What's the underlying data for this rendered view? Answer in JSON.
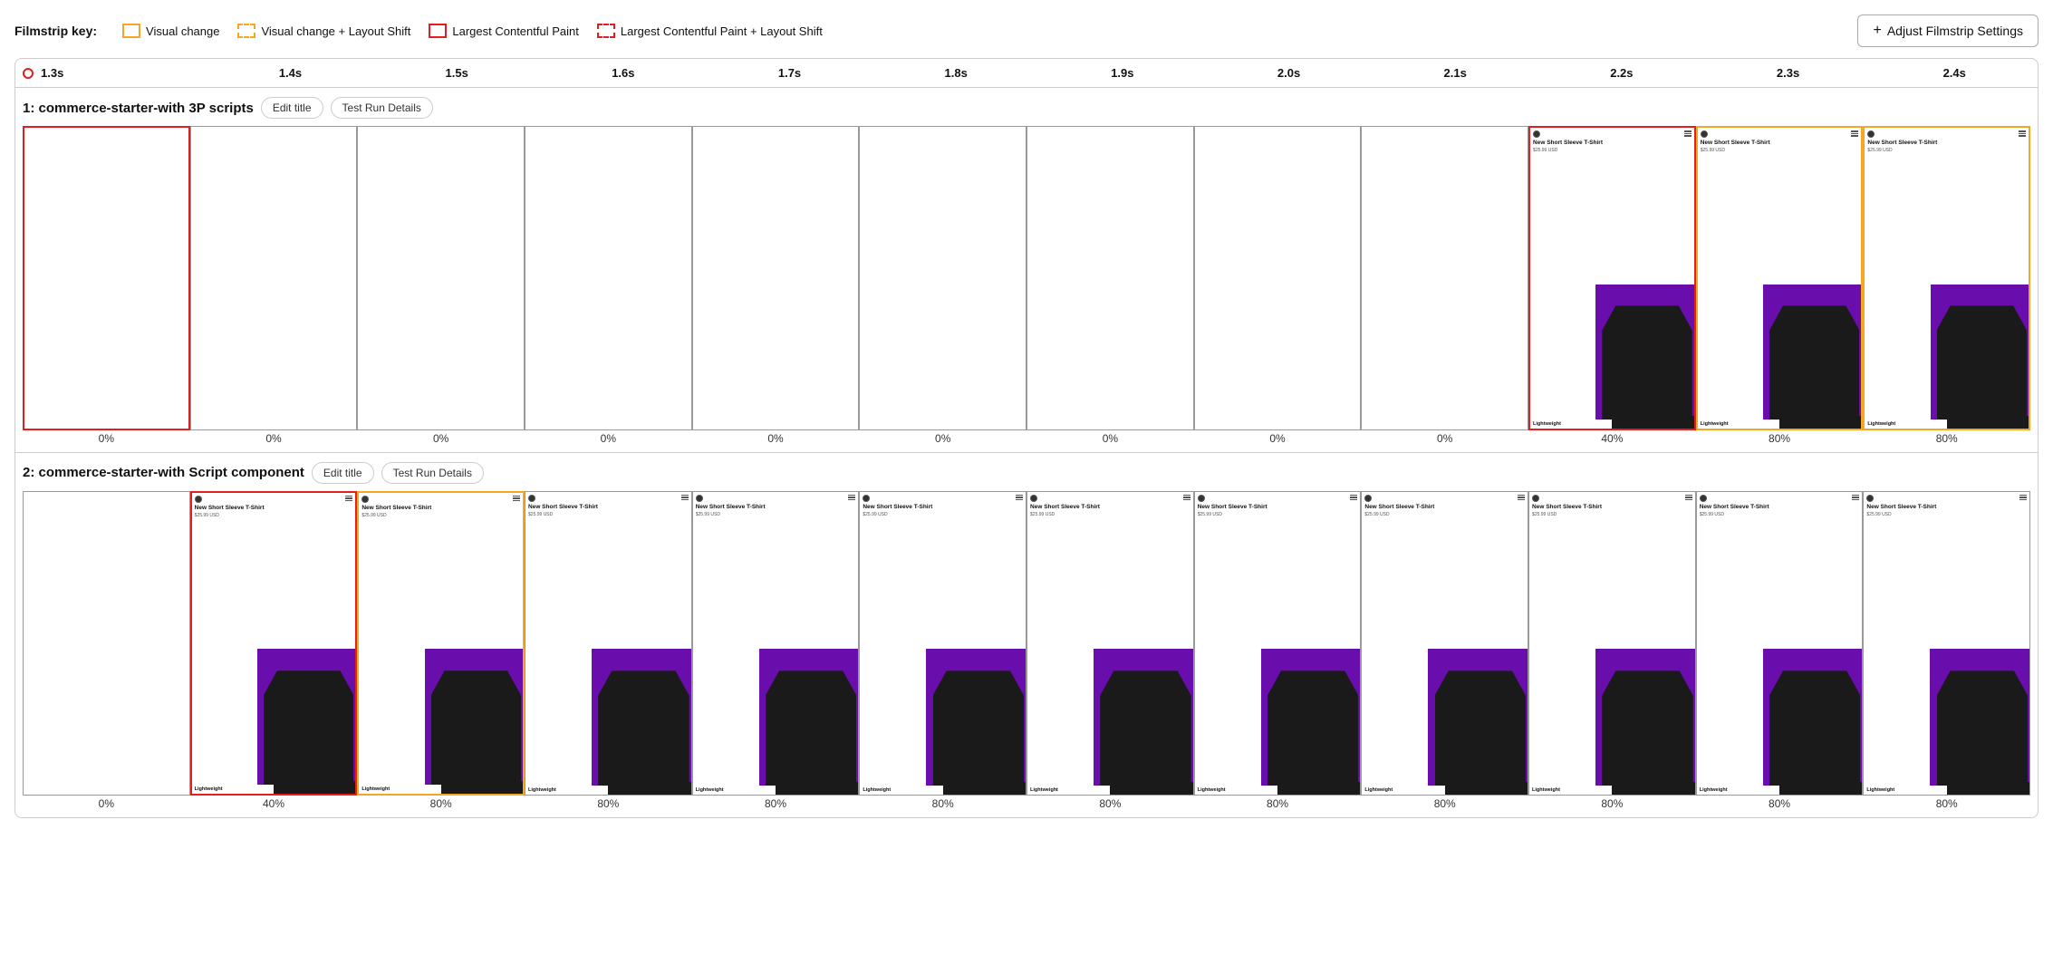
{
  "legend": {
    "key_label": "Filmstrip key:",
    "items": [
      {
        "id": "visual-change",
        "label": "Visual change",
        "type": "visual-change"
      },
      {
        "id": "visual-change-ls",
        "label": "Visual change + Layout Shift",
        "type": "visual-change-ls"
      },
      {
        "id": "lcp",
        "label": "Largest Contentful Paint",
        "type": "lcp"
      },
      {
        "id": "lcp-ls",
        "label": "Largest Contentful Paint + Layout Shift",
        "type": "lcp-ls"
      }
    ],
    "adjust_button": "Adjust Filmstrip Settings"
  },
  "timeline": {
    "ticks": [
      "1.3s",
      "1.4s",
      "1.5s",
      "1.6s",
      "1.7s",
      "1.8s",
      "1.9s",
      "2.0s",
      "2.1s",
      "2.2s",
      "2.3s",
      "2.4s"
    ]
  },
  "sections": [
    {
      "id": "section-1",
      "title": "1: commerce-starter-with 3P scripts",
      "edit_title_label": "Edit title",
      "test_run_label": "Test Run Details",
      "frames": [
        {
          "border": "red",
          "empty": true,
          "pct": "0%"
        },
        {
          "border": "gray",
          "empty": true,
          "pct": "0%"
        },
        {
          "border": "gray",
          "empty": true,
          "pct": "0%"
        },
        {
          "border": "gray",
          "empty": true,
          "pct": "0%"
        },
        {
          "border": "gray",
          "empty": true,
          "pct": "0%"
        },
        {
          "border": "gray",
          "empty": true,
          "pct": "0%"
        },
        {
          "border": "gray",
          "empty": true,
          "pct": "0%"
        },
        {
          "border": "gray",
          "empty": true,
          "pct": "0%"
        },
        {
          "border": "gray",
          "empty": true,
          "pct": "0%"
        },
        {
          "border": "red",
          "empty": false,
          "pct": "40%"
        },
        {
          "border": "orange",
          "empty": false,
          "pct": "80%"
        },
        {
          "border": "orange",
          "empty": false,
          "pct": "80%"
        }
      ]
    },
    {
      "id": "section-2",
      "title": "2: commerce-starter-with Script component",
      "edit_title_label": "Edit title",
      "test_run_label": "Test Run Details",
      "frames": [
        {
          "border": "gray",
          "empty": true,
          "pct": "0%"
        },
        {
          "border": "red",
          "empty": false,
          "pct": "40%"
        },
        {
          "border": "orange",
          "empty": false,
          "pct": "80%"
        },
        {
          "border": "gray",
          "empty": false,
          "pct": "80%"
        },
        {
          "border": "gray",
          "empty": false,
          "pct": "80%"
        },
        {
          "border": "gray",
          "empty": false,
          "pct": "80%"
        },
        {
          "border": "gray",
          "empty": false,
          "pct": "80%"
        },
        {
          "border": "gray",
          "empty": false,
          "pct": "80%"
        },
        {
          "border": "gray",
          "empty": false,
          "pct": "80%"
        },
        {
          "border": "gray",
          "empty": false,
          "pct": "80%"
        },
        {
          "border": "gray",
          "empty": false,
          "pct": "80%"
        },
        {
          "border": "gray",
          "empty": false,
          "pct": "80%"
        }
      ]
    }
  ],
  "product": {
    "title": "New Short Sleeve T-Shirt",
    "price": "$25.99 USD",
    "label": "Lightweight"
  }
}
